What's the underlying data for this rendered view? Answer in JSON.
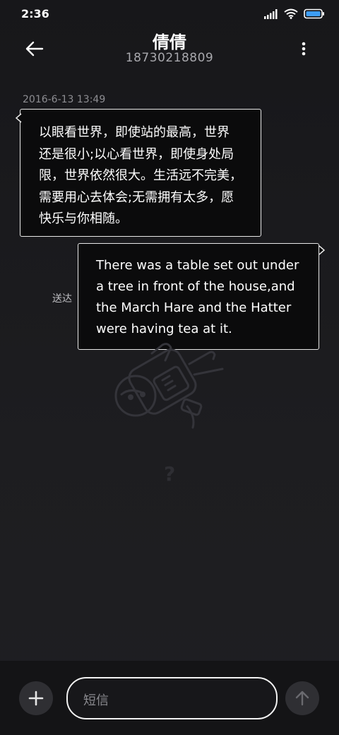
{
  "status_bar": {
    "time": "2:36",
    "icons": [
      "signal-icon",
      "wifi-icon",
      "battery-icon"
    ]
  },
  "header": {
    "contact_name": "倩倩",
    "phone_number": "18730218809",
    "back_icon": "arrow-left-icon",
    "menu_icon": "more-vertical-icon"
  },
  "conversation": {
    "timestamp": "2016-6-13 13:49",
    "messages": [
      {
        "direction": "incoming",
        "text": "以眼看世界，即使站的最高，世界\n还是很小;以心看世界，即使身处局\n限，世界依然很大。生活远不完美，\n需要用心去体会;无需拥有太多，愿\n快乐与你相随。"
      },
      {
        "direction": "outgoing",
        "text": "There was a table set out under\na tree in front of the house,and\nthe March Hare and the Hatter\nwere having tea at it.",
        "status": "送达"
      }
    ]
  },
  "composer": {
    "placeholder": "短信",
    "add_icon": "plus-icon",
    "send_icon": "arrow-up-icon"
  },
  "colors": {
    "background": "#1a1a1d",
    "bubble_fill": "#0b0b0c",
    "bubble_border": "#e8e8e8",
    "muted_text": "#8d8d92",
    "button_fill": "#2f2f33"
  }
}
